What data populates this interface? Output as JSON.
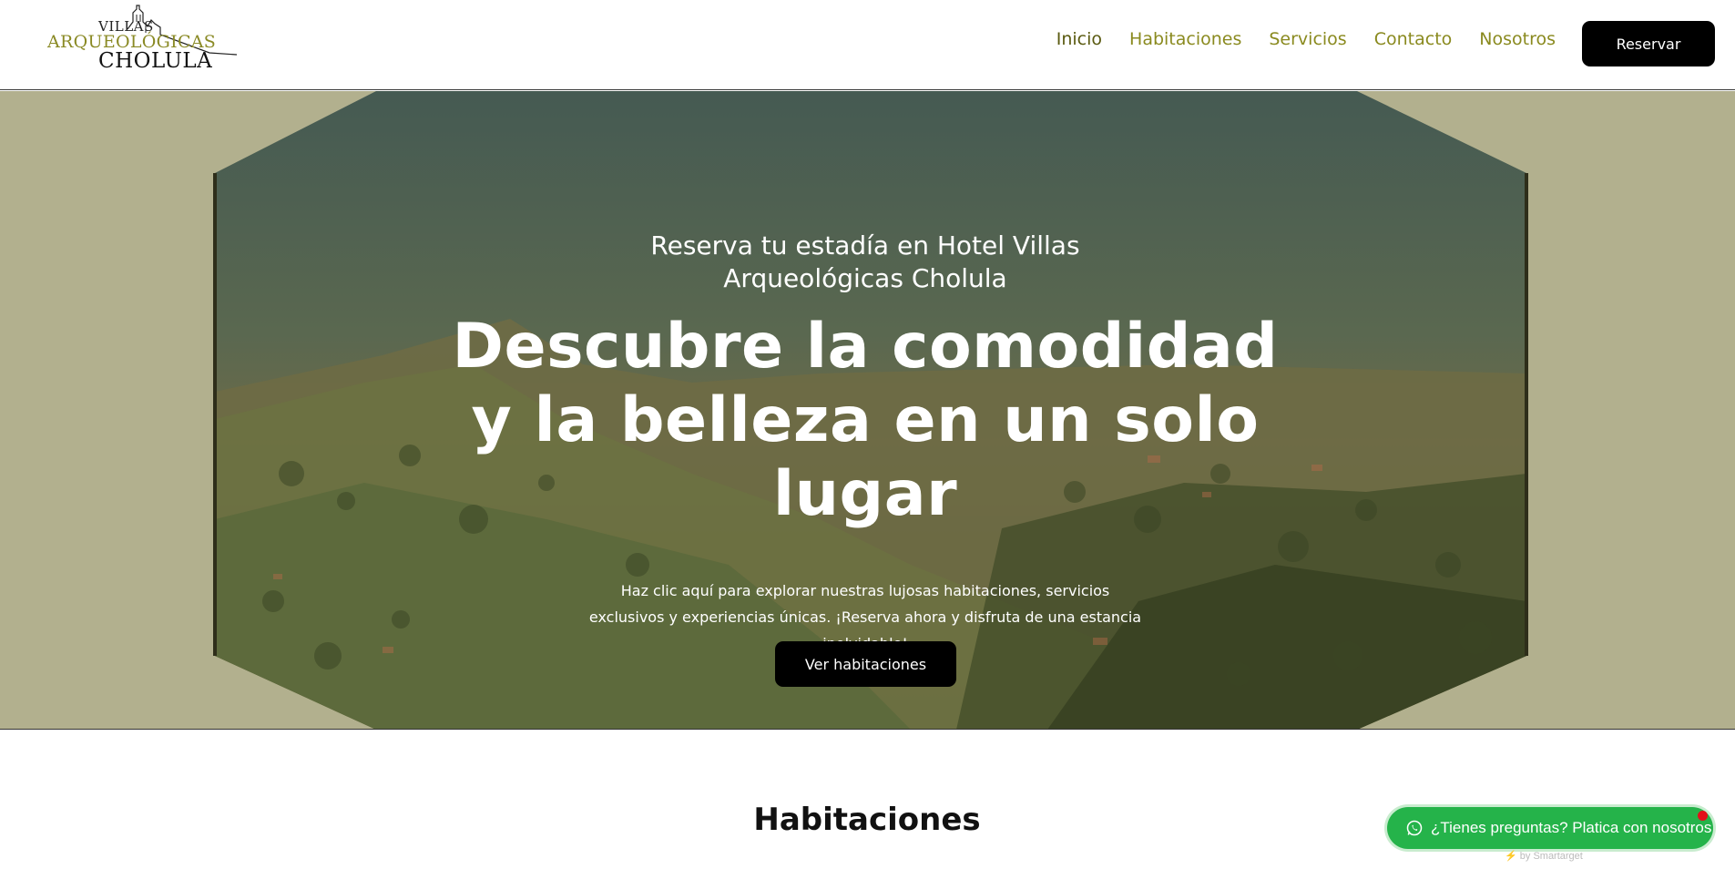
{
  "header": {
    "logo": {
      "line1": "VILLAS",
      "line2": "ARQUEOLÓGICAS",
      "line3": "CHOLULA"
    },
    "nav": [
      {
        "label": "Inicio",
        "active": true
      },
      {
        "label": "Habitaciones",
        "active": false
      },
      {
        "label": "Servicios",
        "active": false
      },
      {
        "label": "Contacto",
        "active": false
      },
      {
        "label": "Nosotros",
        "active": false
      }
    ],
    "reserve_label": "Reservar"
  },
  "hero": {
    "kicker": "Reserva tu estadía en Hotel Villas Arqueológicas Cholula",
    "headline": "Descubre la comodidad y la belleza en un solo lugar",
    "description": "Haz clic aquí para explorar nuestras lujosas habitaciones, servicios exclusivos y experiencias únicas. ¡Reserva ahora y disfruta de una estancia inolvidable!",
    "button_label": "Ver habitaciones"
  },
  "section": {
    "title": "Habitaciones"
  },
  "chat_widget": {
    "label": "¿Tienes preguntas? Platica con nosotros",
    "powered_by": "by Smartarget",
    "icon": "whatsapp-icon"
  },
  "colors": {
    "nav_text": "#8a8a1f",
    "hero_backdrop": "#b2b08e",
    "button_bg": "#000000",
    "chat_green": "#25b34a"
  }
}
